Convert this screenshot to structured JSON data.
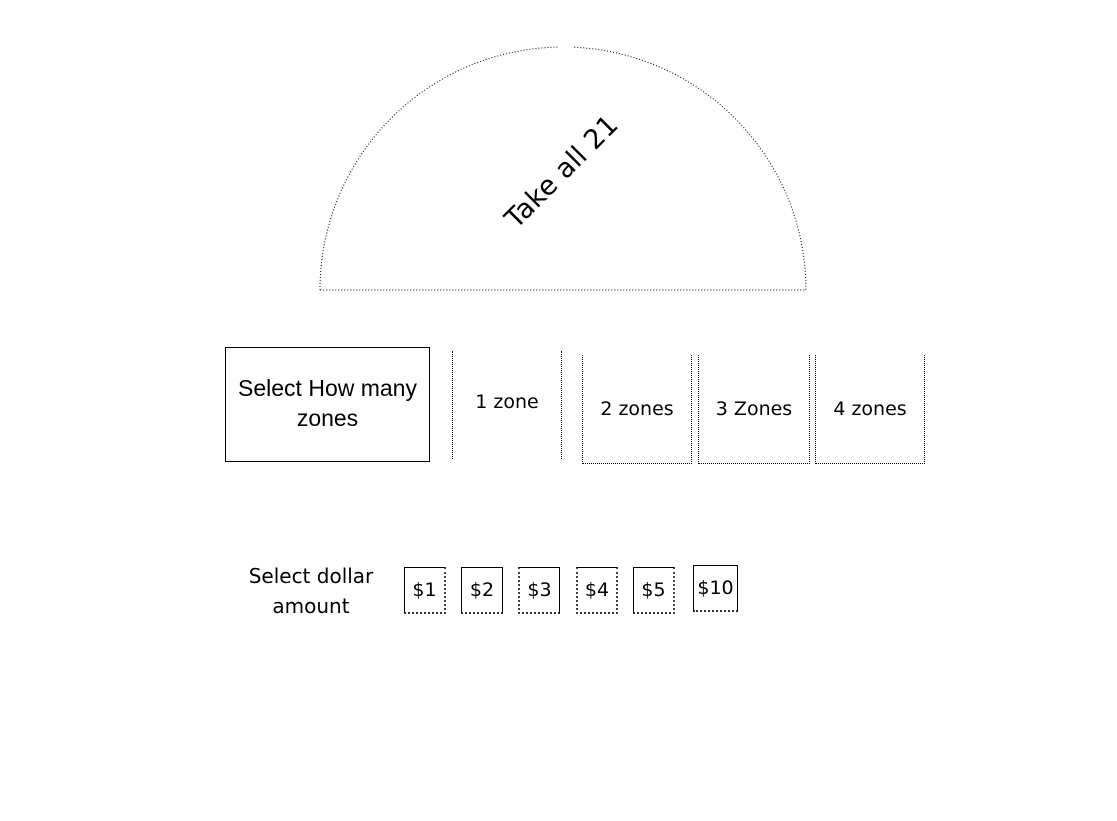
{
  "dome": {
    "label": "Take all 21"
  },
  "zones": {
    "prompt": "Select How many zones",
    "options": [
      {
        "label": "1 zone",
        "count": 1
      },
      {
        "label": "2 zones",
        "count": 2
      },
      {
        "label": "3 Zones",
        "count": 3
      },
      {
        "label": "4 zones",
        "count": 4
      }
    ]
  },
  "dollars": {
    "prompt": "Select dollar amount",
    "options": [
      {
        "label": "$1",
        "amount": 1
      },
      {
        "label": "$2",
        "amount": 2
      },
      {
        "label": "$3",
        "amount": 3
      },
      {
        "label": "$4",
        "amount": 4
      },
      {
        "label": "$5",
        "amount": 5
      },
      {
        "label": "$10",
        "amount": 10
      }
    ]
  }
}
